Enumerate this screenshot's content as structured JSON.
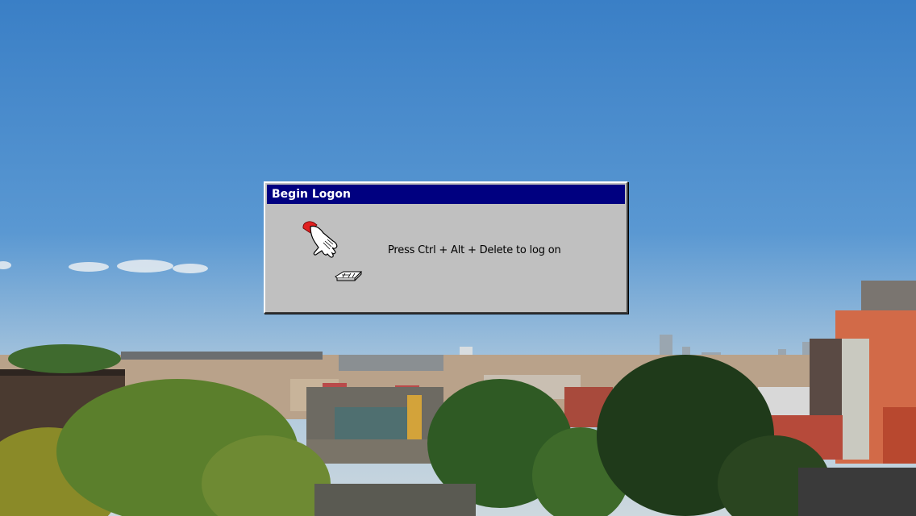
{
  "dialog": {
    "title": "Begin Logon",
    "message": "Press Ctrl + Alt + Delete to log on",
    "hand_icon": "hand-pressing-keys-icon",
    "keys_icon": "keyboard-keys-icon"
  },
  "colors": {
    "title_bar": "#000080",
    "dialog_face": "#c0c0c0",
    "sky": "#3f86c9",
    "hand_cuff": "#e02020"
  }
}
